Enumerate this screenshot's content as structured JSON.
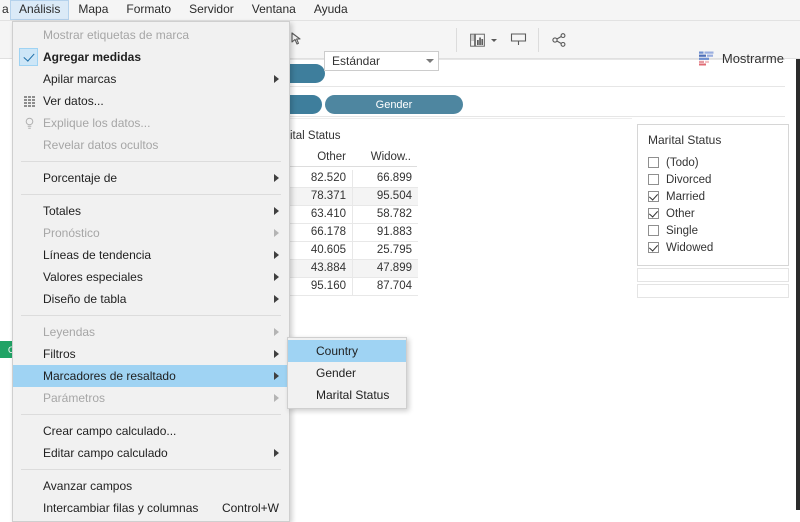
{
  "menubar": {
    "clipped_left_item": "a",
    "items": [
      {
        "label": "Análisis",
        "active": true
      },
      {
        "label": "Mapa",
        "active": false
      },
      {
        "label": "Formato",
        "active": false
      },
      {
        "label": "Servidor",
        "active": false
      },
      {
        "label": "Ventana",
        "active": false
      },
      {
        "label": "Ayuda",
        "active": false
      }
    ]
  },
  "toolbar": {
    "fit_value": "Estándar",
    "show_me_label": "Mostrarme",
    "icons": {
      "highlight": "highlighter-icon",
      "chart_type": "chart-type-icon",
      "presentation": "presentation-mode-icon",
      "share": "share-icon",
      "show_me": "show-me-icon"
    }
  },
  "shelf": {
    "pills": [
      {
        "label": "",
        "name": "pill-fragment-rows"
      },
      {
        "label": "",
        "name": "pill-fragment-columns"
      },
      {
        "label": "Gender",
        "name": "pill-gender"
      }
    ],
    "green_pill_fragment": "OL"
  },
  "analysis_menu": {
    "items": [
      {
        "label": "Mostrar etiquetas de marca",
        "disabled": true,
        "arrow": false,
        "icon": null,
        "accel": "",
        "highlighted": false
      },
      {
        "label": "Agregar medidas",
        "disabled": false,
        "arrow": false,
        "icon": "check-icon",
        "accel": "",
        "highlighted": false
      },
      {
        "label": "Apilar marcas",
        "disabled": false,
        "arrow": true,
        "icon": null,
        "accel": "",
        "highlighted": false
      },
      {
        "label": "Ver datos...",
        "disabled": false,
        "arrow": false,
        "icon": "grid-icon",
        "accel": "",
        "highlighted": false
      },
      {
        "label": "Explique los datos...",
        "disabled": true,
        "arrow": false,
        "icon": "bulb-icon",
        "accel": "",
        "highlighted": false
      },
      {
        "label": "Revelar datos ocultos",
        "disabled": true,
        "arrow": false,
        "icon": null,
        "accel": "",
        "highlighted": false
      },
      {
        "separator": true
      },
      {
        "label": "Porcentaje de",
        "disabled": false,
        "arrow": true,
        "icon": null,
        "accel": "",
        "highlighted": false
      },
      {
        "separator": true
      },
      {
        "label": "Totales",
        "disabled": false,
        "arrow": true,
        "icon": null,
        "accel": "",
        "highlighted": false
      },
      {
        "label": "Pronóstico",
        "disabled": true,
        "arrow": true,
        "icon": null,
        "accel": "",
        "highlighted": false
      },
      {
        "label": "Líneas de tendencia",
        "disabled": false,
        "arrow": true,
        "icon": null,
        "accel": "",
        "highlighted": false
      },
      {
        "label": "Valores especiales",
        "disabled": false,
        "arrow": true,
        "icon": null,
        "accel": "",
        "highlighted": false
      },
      {
        "label": "Diseño de tabla",
        "disabled": false,
        "arrow": true,
        "icon": null,
        "accel": "",
        "highlighted": false
      },
      {
        "separator": true
      },
      {
        "label": "Leyendas",
        "disabled": true,
        "arrow": true,
        "icon": null,
        "accel": "",
        "highlighted": false
      },
      {
        "label": "Filtros",
        "disabled": false,
        "arrow": true,
        "icon": null,
        "accel": "",
        "highlighted": false
      },
      {
        "label": "Marcadores de resaltado",
        "disabled": false,
        "arrow": true,
        "icon": null,
        "accel": "",
        "highlighted": true
      },
      {
        "label": "Parámetros",
        "disabled": true,
        "arrow": true,
        "icon": null,
        "accel": "",
        "highlighted": false
      },
      {
        "separator": true
      },
      {
        "label": "Crear campo calculado...",
        "disabled": false,
        "arrow": false,
        "icon": null,
        "accel": "",
        "highlighted": false
      },
      {
        "label": "Editar campo calculado",
        "disabled": false,
        "arrow": true,
        "icon": null,
        "accel": "",
        "highlighted": false
      },
      {
        "separator": true
      },
      {
        "label": "Avanzar campos",
        "disabled": false,
        "arrow": false,
        "icon": null,
        "accel": "",
        "highlighted": false
      },
      {
        "label": "Intercambiar filas y columnas",
        "disabled": false,
        "arrow": false,
        "icon": null,
        "accel": "Control+W",
        "highlighted": false
      }
    ]
  },
  "highlight_submenu": {
    "items": [
      {
        "label": "Country",
        "highlighted": true
      },
      {
        "label": "Gender",
        "highlighted": false
      },
      {
        "label": "Marital Status",
        "highlighted": false
      }
    ]
  },
  "table": {
    "group_label": "ital Status",
    "columns": [
      "Other",
      "Widow.."
    ],
    "rows": [
      [
        "82.520",
        "66.899"
      ],
      [
        "78.371",
        "95.504"
      ],
      [
        "63.410",
        "58.782"
      ],
      [
        "66.178",
        "91.883"
      ],
      [
        "40.605",
        "25.795"
      ],
      [
        "43.884",
        "47.899"
      ],
      [
        "95.160",
        "87.704"
      ]
    ]
  },
  "filter_card": {
    "title": "Marital Status",
    "items": [
      {
        "label": "(Todo)",
        "checked": false
      },
      {
        "label": "Divorced",
        "checked": false
      },
      {
        "label": "Married",
        "checked": true
      },
      {
        "label": "Other",
        "checked": true
      },
      {
        "label": "Single",
        "checked": false
      },
      {
        "label": "Widowed",
        "checked": true
      }
    ]
  },
  "colors": {
    "menu_bg": "#f1f1f1",
    "highlight_blue": "#9fd3f3",
    "pill_blue": "#4e86a0",
    "pill_green": "#21a366",
    "menubar_active": "#dbeaf7"
  }
}
